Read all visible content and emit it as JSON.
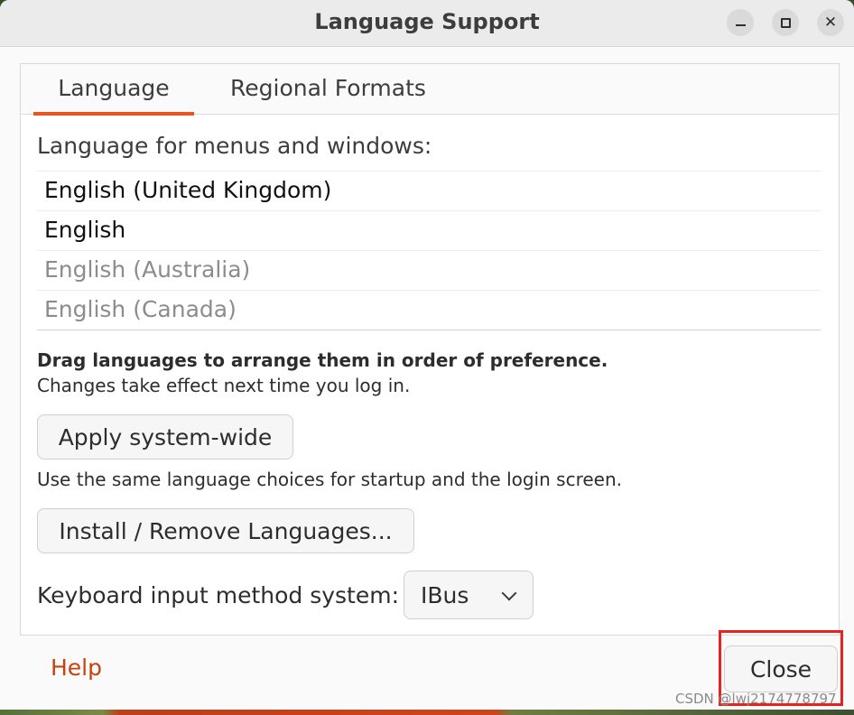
{
  "window": {
    "title": "Language Support"
  },
  "tabs": [
    {
      "label": "Language",
      "active": true
    },
    {
      "label": "Regional Formats",
      "active": false
    }
  ],
  "language_tab": {
    "section_label": "Language for menus and windows:",
    "languages": [
      {
        "label": "English (United Kingdom)",
        "state": "active"
      },
      {
        "label": "English",
        "state": "active"
      },
      {
        "label": "English (Australia)",
        "state": "inactive"
      },
      {
        "label": "English (Canada)",
        "state": "inactive"
      }
    ],
    "drag_hint": "Drag languages to arrange them in order of preference.",
    "effect_hint": "Changes take effect next time you log in.",
    "apply_button": "Apply system-wide",
    "apply_hint": "Use the same language choices for startup and the login screen.",
    "install_button": "Install / Remove Languages...",
    "keyboard_label": "Keyboard input method system:",
    "keyboard_value": "IBus"
  },
  "footer": {
    "help_label": "Help",
    "close_label": "Close"
  },
  "watermark": "CSDN @lwj2174778797",
  "colors": {
    "accent": "#e95420",
    "help_link": "#c7410d",
    "highlight_box": "#e8231f"
  },
  "icons": {
    "minimize": "minimize-icon",
    "maximize": "maximize-icon",
    "close": "close-icon",
    "combo": "chevron-down-icon"
  }
}
